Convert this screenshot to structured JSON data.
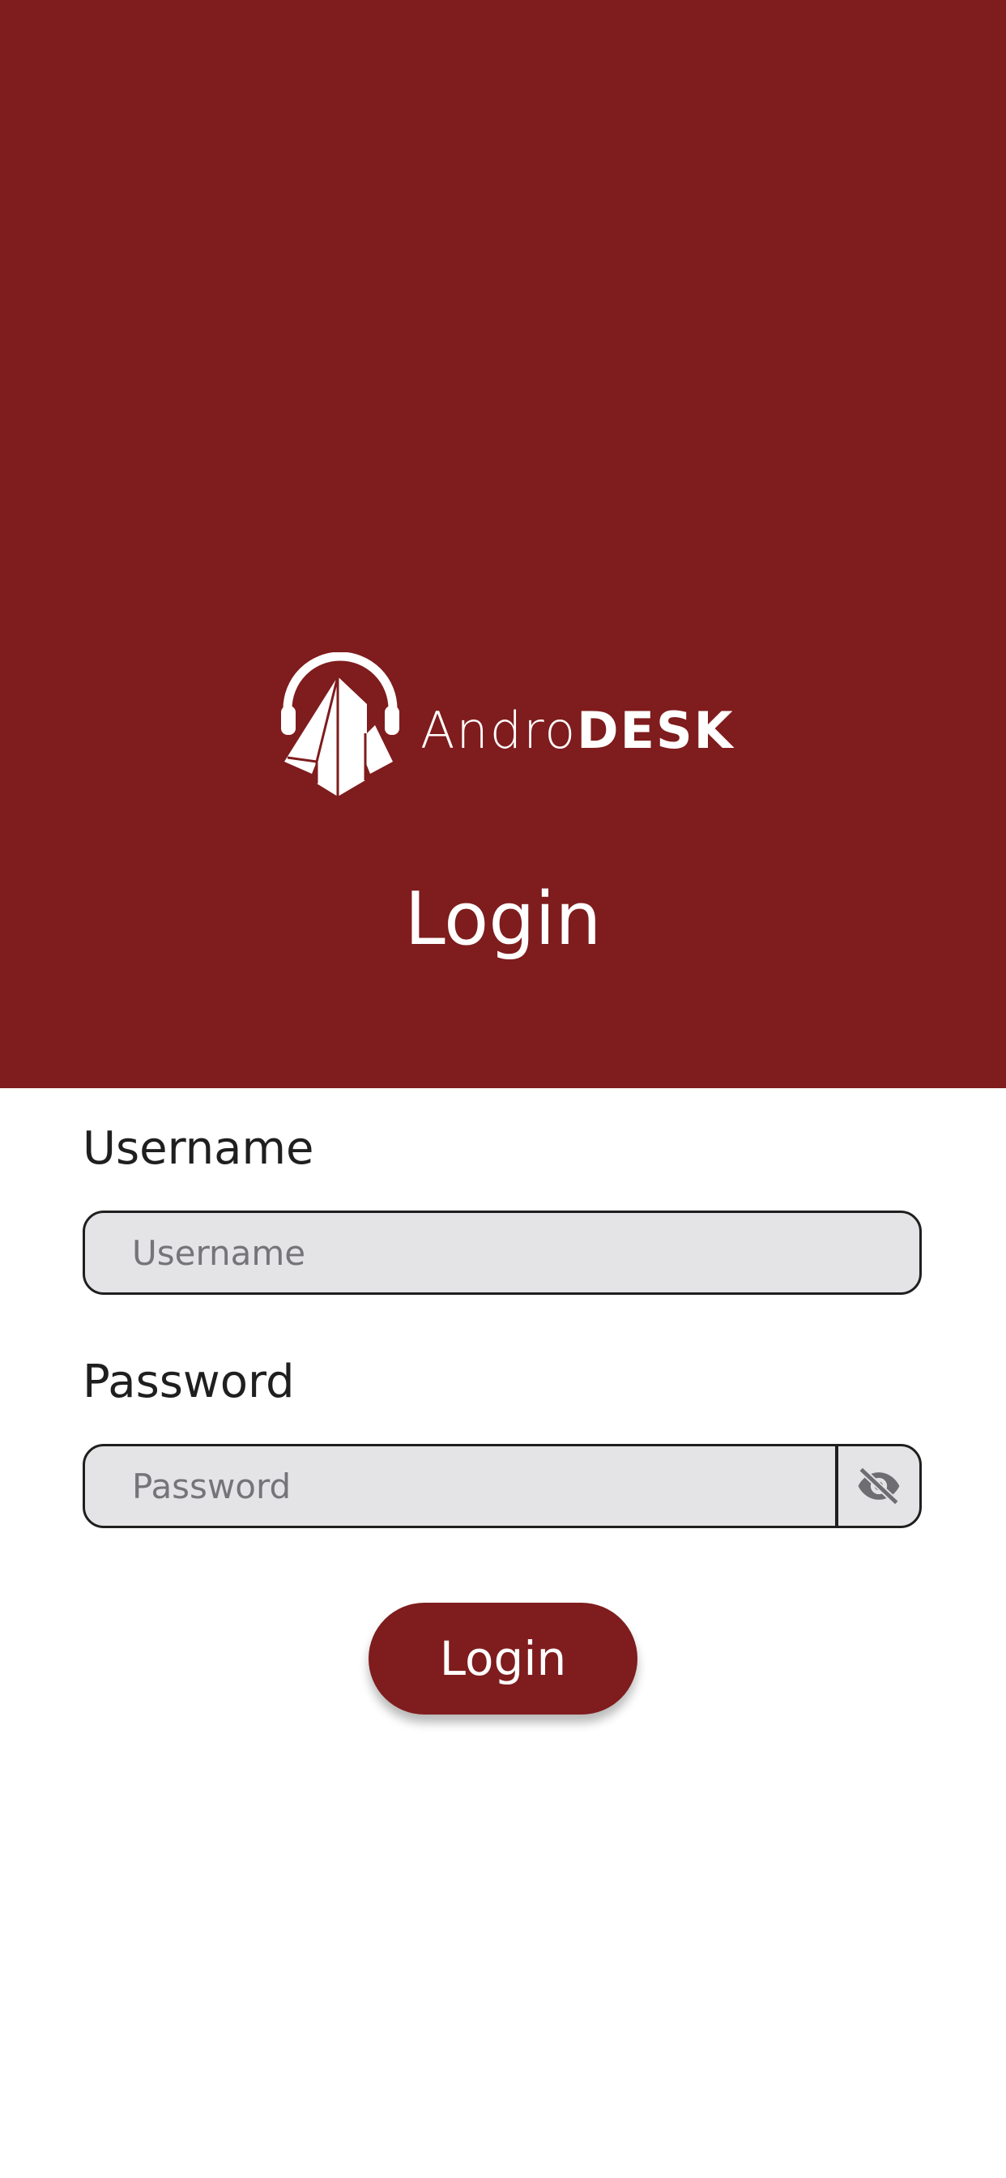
{
  "brand": {
    "name_light": "Andro",
    "name_bold": "DESK"
  },
  "page": {
    "title": "Login"
  },
  "form": {
    "username_label": "Username",
    "username_placeholder": "Username",
    "password_label": "Password",
    "password_placeholder": "Password",
    "submit_label": "Login"
  },
  "icons": {
    "logo": "headset-arrow-logo",
    "password_toggle": "eye-off-icon"
  },
  "colors": {
    "brand": "#7f1c1d",
    "input_bg": "#e4e4e6",
    "text": "#1f1f1f",
    "placeholder": "#757579"
  }
}
